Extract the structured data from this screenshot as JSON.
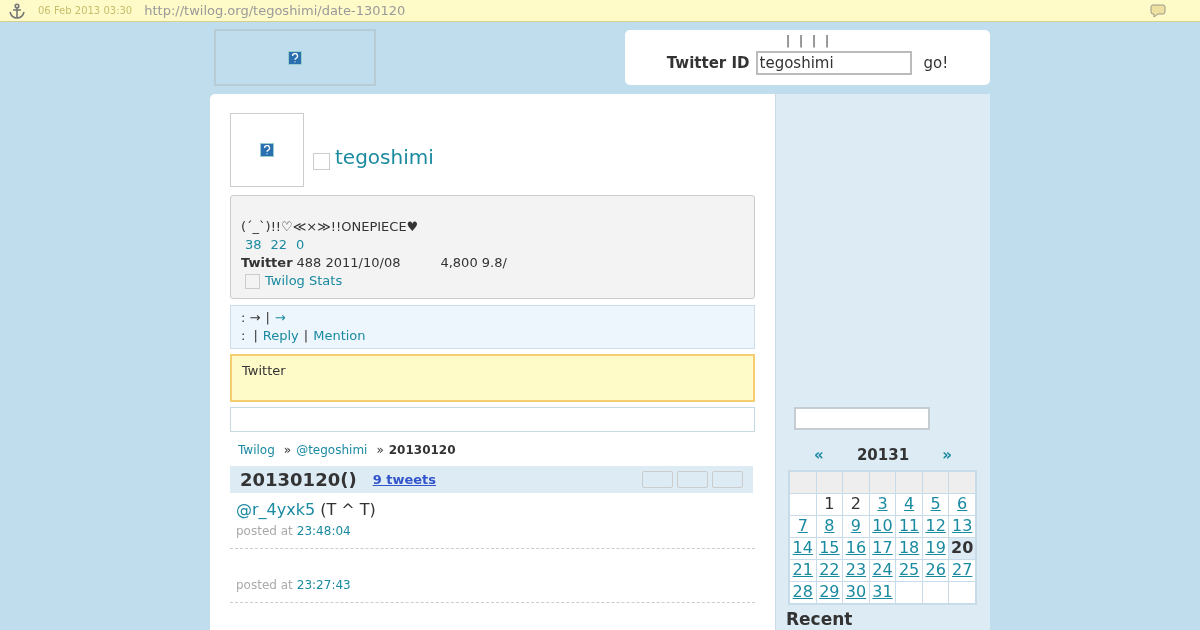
{
  "archive_bar": {
    "date": "06 Feb 2013 03:30",
    "url": "http://twilog.org/tegoshimi/date-130120"
  },
  "header": {
    "nav": [
      "|",
      "|",
      "|",
      "|"
    ],
    "id_label": "Twitter ID",
    "id_value": "tegoshimi",
    "go": "go!"
  },
  "profile": {
    "name": "tegoshimi",
    "bio": "(´_`)!!♡≪×≫!!ONEPIECE♥",
    "counts": [
      "38",
      "22",
      "0"
    ],
    "twitter_label": "Twitter",
    "twitter_info": "488 2011/10/08",
    "stats_info": "4,800 9.8/",
    "stats_link": "Twilog Stats"
  },
  "links_box": {
    "line1_prefix": ": →",
    "line1_sep": "|",
    "line1_link": "→",
    "line2_prefix": ":",
    "link_sep": "|",
    "links": [
      "Reply",
      "Mention"
    ]
  },
  "notice": "Twitter",
  "breadcrumb": {
    "links": [
      "Twilog",
      "@tegoshimi"
    ],
    "sep": "»",
    "current": "20130120"
  },
  "day_header": {
    "title": "20130120()",
    "count": "9 tweets"
  },
  "tweets": [
    {
      "mention": "@r_4yxk5",
      "text": "(T ^ T)",
      "posted_label": "posted at",
      "time": "23:48:04"
    },
    {
      "posted_label": "posted at",
      "time": "23:27:43"
    }
  ],
  "calendar": {
    "prev": "«",
    "title": "20131",
    "next": "»",
    "days": [
      {
        "kind": "blank"
      },
      {
        "kind": "day",
        "label": "1",
        "linked": false,
        "selected": false
      },
      {
        "label": "2",
        "linked": false,
        "selected": false
      },
      {
        "label": "3",
        "linked": true,
        "selected": false
      },
      {
        "label": "4",
        "linked": true,
        "selected": false
      },
      {
        "label": "5",
        "linked": true,
        "selected": false
      },
      {
        "label": "6",
        "linked": true,
        "selected": false
      },
      {
        "label": "7",
        "linked": true,
        "selected": false
      },
      {
        "label": "8",
        "linked": true,
        "selected": false
      },
      {
        "label": "9",
        "linked": true,
        "selected": false
      },
      {
        "label": "10",
        "linked": true,
        "selected": false
      },
      {
        "label": "11",
        "linked": true,
        "selected": false
      },
      {
        "label": "12",
        "linked": true,
        "selected": false
      },
      {
        "label": "13",
        "linked": true,
        "selected": false
      },
      {
        "label": "14",
        "linked": true,
        "selected": false
      },
      {
        "label": "15",
        "linked": true,
        "selected": false
      },
      {
        "label": "16",
        "linked": true,
        "selected": false
      },
      {
        "label": "17",
        "linked": true,
        "selected": false
      },
      {
        "label": "18",
        "linked": true,
        "selected": false
      },
      {
        "label": "19",
        "linked": true,
        "selected": false
      },
      {
        "label": "20",
        "linked": false,
        "selected": true
      },
      {
        "label": "21",
        "linked": true,
        "selected": false
      },
      {
        "label": "22",
        "linked": true,
        "selected": false
      },
      {
        "label": "23",
        "linked": true,
        "selected": false
      },
      {
        "label": "24",
        "linked": true,
        "selected": false
      },
      {
        "label": "25",
        "linked": true,
        "selected": false
      },
      {
        "label": "26",
        "linked": true,
        "selected": false
      },
      {
        "label": "27",
        "linked": true,
        "selected": false
      },
      {
        "label": "28",
        "linked": true,
        "selected": false
      },
      {
        "label": "29",
        "linked": true,
        "selected": false
      },
      {
        "label": "30",
        "linked": true,
        "selected": false
      },
      {
        "label": "31",
        "linked": true,
        "selected": false
      },
      {
        "kind": "blank"
      },
      {
        "kind": "blank"
      },
      {
        "kind": "blank"
      }
    ]
  },
  "recent_heading": "Recent"
}
